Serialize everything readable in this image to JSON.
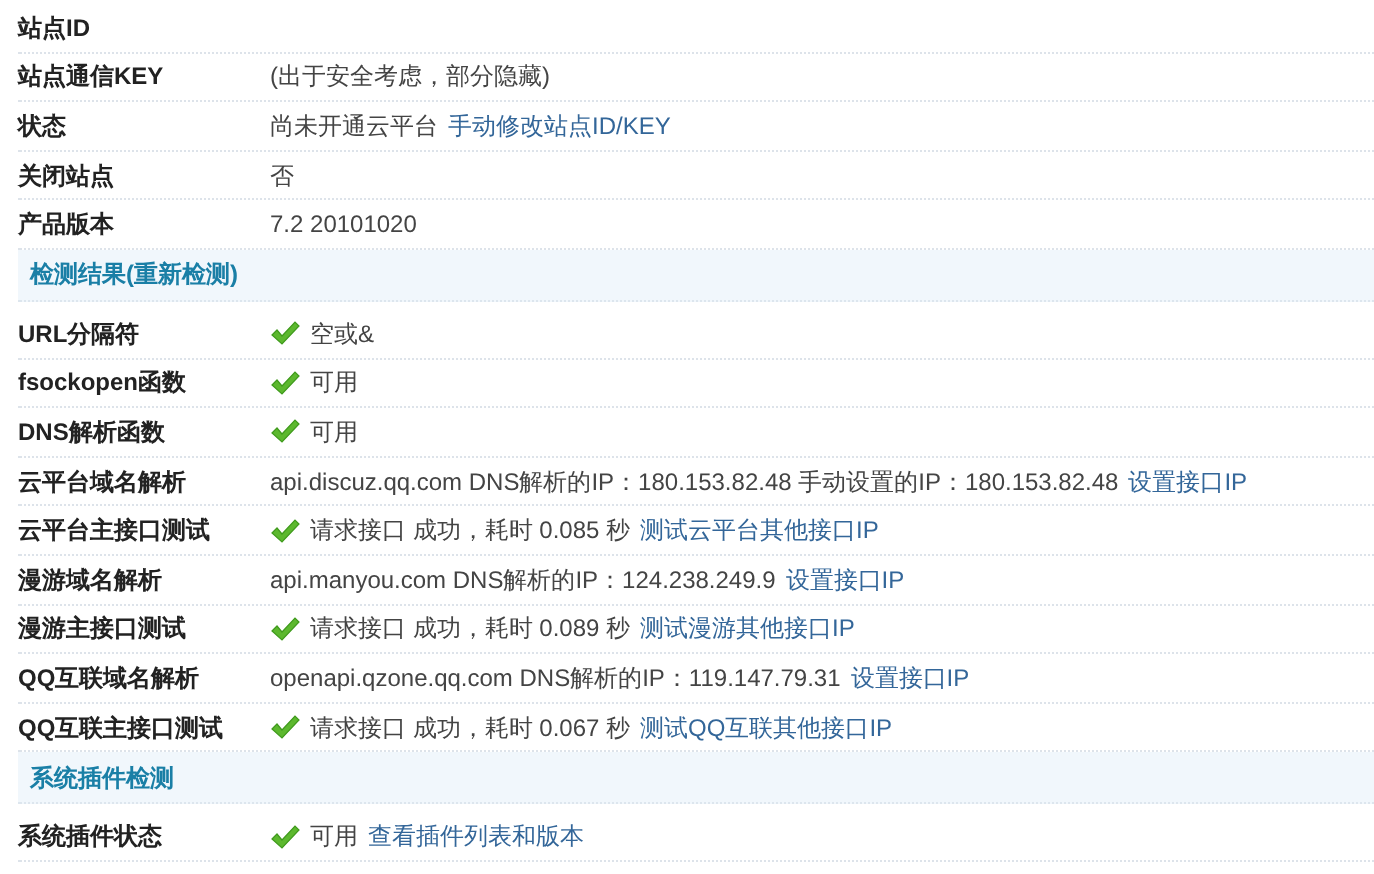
{
  "sections": [
    {
      "rows": [
        {
          "label": "站点ID",
          "ok": false,
          "parts": []
        },
        {
          "label": "站点通信KEY",
          "ok": false,
          "parts": [
            {
              "kind": "text",
              "text": "(出于安全考虑，部分隐藏)"
            }
          ]
        },
        {
          "label": "状态",
          "ok": false,
          "parts": [
            {
              "kind": "text",
              "text": "尚未开通云平台"
            },
            {
              "kind": "link",
              "text": "手动修改站点ID/KEY"
            }
          ]
        },
        {
          "label": "关闭站点",
          "ok": false,
          "parts": [
            {
              "kind": "text",
              "text": "否"
            }
          ]
        },
        {
          "label": "产品版本",
          "ok": false,
          "parts": [
            {
              "kind": "text",
              "text": "7.2 20101020"
            }
          ]
        }
      ]
    },
    {
      "title": "检测结果(重新检测)",
      "rows": [
        {
          "label": "URL分隔符",
          "ok": true,
          "parts": [
            {
              "kind": "text",
              "text": "空或&"
            }
          ]
        },
        {
          "label": "fsockopen函数",
          "ok": true,
          "parts": [
            {
              "kind": "text",
              "text": "可用"
            }
          ]
        },
        {
          "label": "DNS解析函数",
          "ok": true,
          "parts": [
            {
              "kind": "text",
              "text": "可用"
            }
          ]
        },
        {
          "label": "云平台域名解析",
          "ok": false,
          "parts": [
            {
              "kind": "text",
              "text": "api.discuz.qq.com DNS解析的IP：180.153.82.48 手动设置的IP：180.153.82.48"
            },
            {
              "kind": "link",
              "text": "设置接口IP"
            }
          ]
        },
        {
          "label": "云平台主接口测试",
          "ok": true,
          "parts": [
            {
              "kind": "text",
              "text": "请求接口 成功，耗时 0.085 秒"
            },
            {
              "kind": "link",
              "text": "测试云平台其他接口IP"
            }
          ]
        },
        {
          "label": "漫游域名解析",
          "ok": false,
          "parts": [
            {
              "kind": "text",
              "text": "api.manyou.com DNS解析的IP：124.238.249.9"
            },
            {
              "kind": "link",
              "text": "设置接口IP"
            }
          ]
        },
        {
          "label": "漫游主接口测试",
          "ok": true,
          "parts": [
            {
              "kind": "text",
              "text": "请求接口 成功，耗时 0.089 秒"
            },
            {
              "kind": "link",
              "text": "测试漫游其他接口IP"
            }
          ]
        },
        {
          "label": "QQ互联域名解析",
          "ok": false,
          "parts": [
            {
              "kind": "text",
              "text": "openapi.qzone.qq.com DNS解析的IP：119.147.79.31"
            },
            {
              "kind": "link",
              "text": "设置接口IP"
            }
          ]
        },
        {
          "label": "QQ互联主接口测试",
          "ok": true,
          "parts": [
            {
              "kind": "text",
              "text": "请求接口 成功，耗时 0.067 秒"
            },
            {
              "kind": "link",
              "text": "测试QQ互联其他接口IP"
            }
          ]
        }
      ]
    },
    {
      "title": "系统插件检测",
      "rows": [
        {
          "label": "系统插件状态",
          "ok": true,
          "parts": [
            {
              "kind": "text",
              "text": "可用"
            },
            {
              "kind": "link",
              "text": "查看插件列表和版本"
            }
          ]
        }
      ]
    }
  ]
}
